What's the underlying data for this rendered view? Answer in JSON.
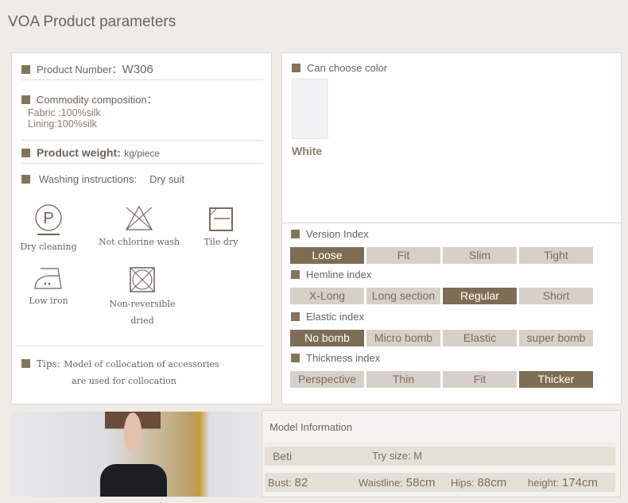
{
  "title": "VOA Product parameters",
  "left": {
    "product_number_label": "Product Number：",
    "product_number": "W306",
    "composition_label": "Commodity composition：",
    "fabric": "Fabric  :100%silk",
    "lining": "Lining:100%silk",
    "weight_label": "Product  weight:",
    "weight_unit": "kg/piece",
    "washing_label": "Washing instructions:",
    "washing_value": "Dry suit",
    "care": [
      {
        "icon": "dry-clean-p-icon",
        "label": "Dry cleaning"
      },
      {
        "icon": "no-chlorine-icon",
        "label": "Not chlorine wash"
      },
      {
        "icon": "tile-dry-icon",
        "label": "Tile dry"
      },
      {
        "icon": "low-iron-icon",
        "label": "Low iron"
      },
      {
        "icon": "no-tumble-dry-icon",
        "label": "Non-reversible",
        "label2": "dried"
      }
    ],
    "tips_label": "Tips:",
    "tips_line1": "Model of collocation of accessories",
    "tips_line2": "are used for collocation"
  },
  "right": {
    "color_label": "Can choose color",
    "color_name": "White",
    "indices": [
      {
        "label": "Version Index",
        "options": [
          "Loose",
          "Fit",
          "Slim",
          "Tight"
        ],
        "selected": 0
      },
      {
        "label": "Hemline index",
        "options": [
          "X-Long",
          "Long  section",
          "Regular",
          "Short"
        ],
        "selected": 2
      },
      {
        "label": "Elastic index",
        "options": [
          "No  bomb",
          "Micro bomb",
          "Elastic",
          "super  bomb"
        ],
        "selected": 0
      },
      {
        "label": "Thickness index",
        "options": [
          "Perspective",
          "Thin",
          "Fit",
          "Thicker"
        ],
        "selected": 3
      }
    ]
  },
  "model": {
    "title": "Model Information",
    "name": "Beti",
    "try_size": "Try size: M",
    "bust_label": "Bust:",
    "bust": "82",
    "waist_label": "Waistline:",
    "waist": "58cm",
    "hips_label": "Hips:",
    "hips": "88cm",
    "height_label": "height:",
    "height": "174cm"
  },
  "colors": {
    "accent": "#7e6d54",
    "option": "#d7d0c8"
  }
}
